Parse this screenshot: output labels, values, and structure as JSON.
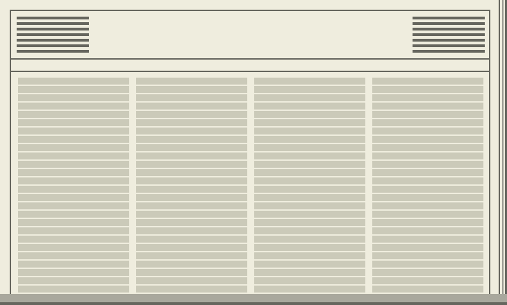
{
  "window": {
    "title": ""
  },
  "header": {
    "left_grip": "grip-lines-icon",
    "right_grip": "grip-lines-icon"
  },
  "columns": [
    {
      "name": "column-1"
    },
    {
      "name": "column-2"
    },
    {
      "name": "column-3"
    },
    {
      "name": "column-4"
    }
  ],
  "colors": {
    "background": "#efedde",
    "border": "#66665e",
    "row_fill": "#cbcab9",
    "scrollbar": "#a9a89d"
  }
}
